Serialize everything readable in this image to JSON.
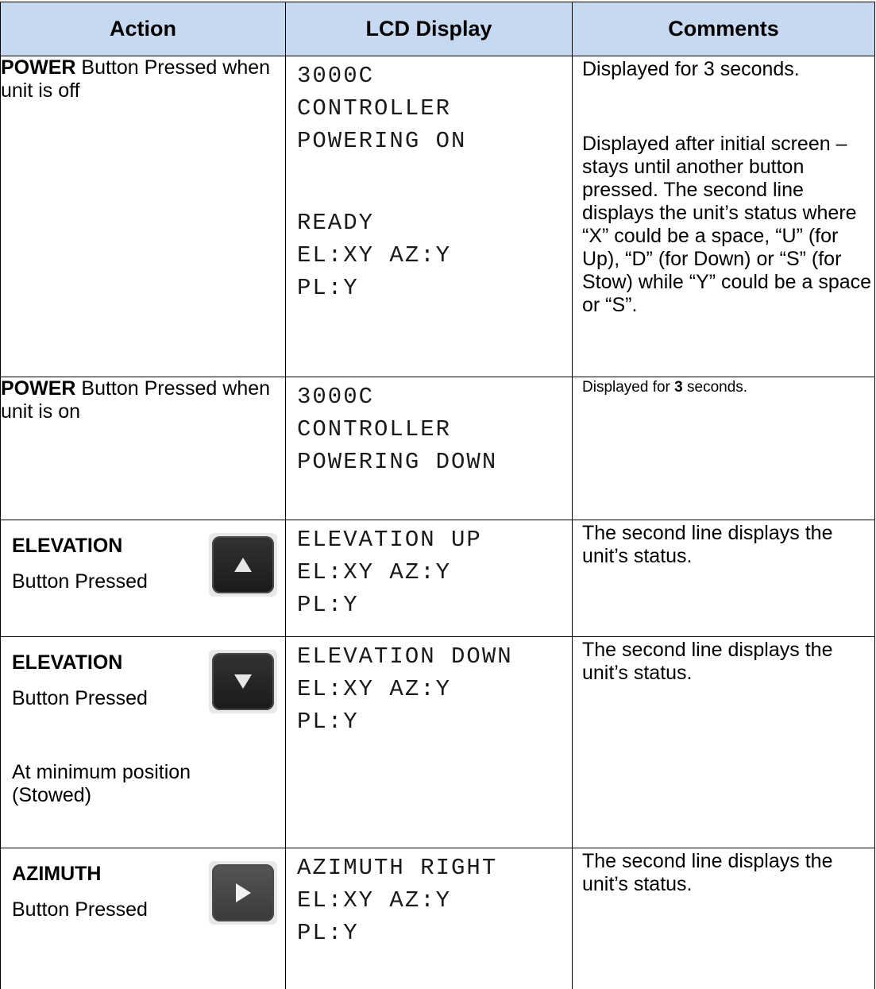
{
  "headers": [
    "Action",
    "LCD Display",
    "Comments"
  ],
  "rows": [
    {
      "action_bold": "POWER",
      "action_rest": " Button Pressed when unit is off",
      "lcd_a": "3000C\nCONTROLLER\nPOWERING ON",
      "lcd_b": "READY\nEL:XY AZ:Y\nPL:Y",
      "comment_a": "Displayed for 3 seconds.",
      "comment_b": "Displayed after initial screen – stays until another button pressed. The second line displays the unit’s status where “X” could be a space, “U” (for Up), “D” (for Down) or “S” (for Stow) while “Y” could be a space or “S”."
    },
    {
      "action_bold": "POWER",
      "action_rest": " Button Pressed when unit is on",
      "lcd": "3000C\nCONTROLLER\nPOWERING DOWN",
      "comment_pre": "Displayed for ",
      "comment_bold": "3",
      "comment_post": " seconds."
    },
    {
      "action_bold": "ELEVATION",
      "action_rest": "Button Pressed",
      "icon": "elevation-up-key-icon",
      "lcd": "ELEVATION UP\nEL:XY AZ:Y\nPL:Y",
      "comment": "The second line displays the unit’s status."
    },
    {
      "action_bold": "ELEVATION",
      "action_rest": "Button Pressed",
      "action_extra": "At minimum position (Stowed)",
      "icon": "elevation-down-key-icon",
      "lcd": "ELEVATION DOWN\nEL:XY AZ:Y\nPL:Y",
      "comment": "The second line displays the unit’s status."
    },
    {
      "action_bold": "AZIMUTH",
      "action_rest": "Button Pressed",
      "icon": "azimuth-right-key-icon",
      "lcd": "AZIMUTH RIGHT\nEL:XY AZ:Y\nPL:Y",
      "comment": "The second line displays the unit’s status."
    }
  ]
}
